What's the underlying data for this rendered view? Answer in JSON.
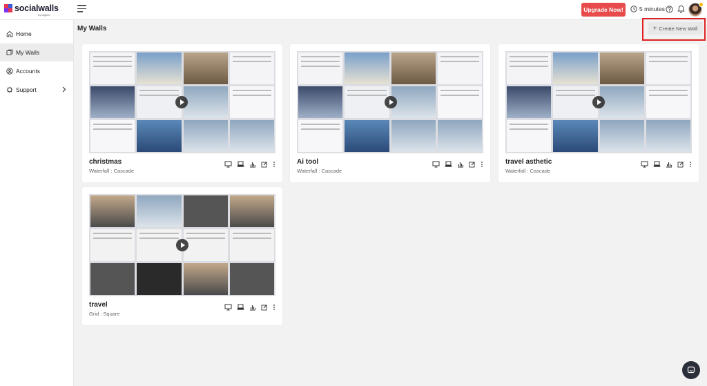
{
  "brand": {
    "name": "socialwalls",
    "sub": "by tagbox"
  },
  "header": {
    "upgrade_label": "Upgrade Now!",
    "timer_label": "5 minutes",
    "icons": [
      "menu-icon",
      "clock-icon",
      "help-icon",
      "bell-icon",
      "avatar"
    ]
  },
  "sidebar": {
    "items": [
      {
        "label": "Home",
        "icon": "home-icon"
      },
      {
        "label": "My Walls",
        "icon": "walls-icon",
        "active": true
      },
      {
        "label": "Accounts",
        "icon": "accounts-icon"
      },
      {
        "label": "Support",
        "icon": "support-icon",
        "has_chevron": true
      }
    ]
  },
  "main": {
    "title": "My Walls",
    "create_label": "Create New Wall",
    "walls": [
      {
        "name": "christmas",
        "layout": "Waterfall : Cascade"
      },
      {
        "name": "Ai tool",
        "layout": "Waterfall : Cascade"
      },
      {
        "name": "travel asthetic",
        "layout": "Waterfall : Cascade"
      },
      {
        "name": "travel",
        "layout": "Grid : Square"
      }
    ],
    "card_actions": [
      "monitor-icon",
      "display-icon",
      "analytics-icon",
      "edit-icon",
      "more-icon"
    ]
  },
  "colors": {
    "accent": "#e84b4b",
    "highlight": "#e02020",
    "chat": "#2b2f3a"
  }
}
